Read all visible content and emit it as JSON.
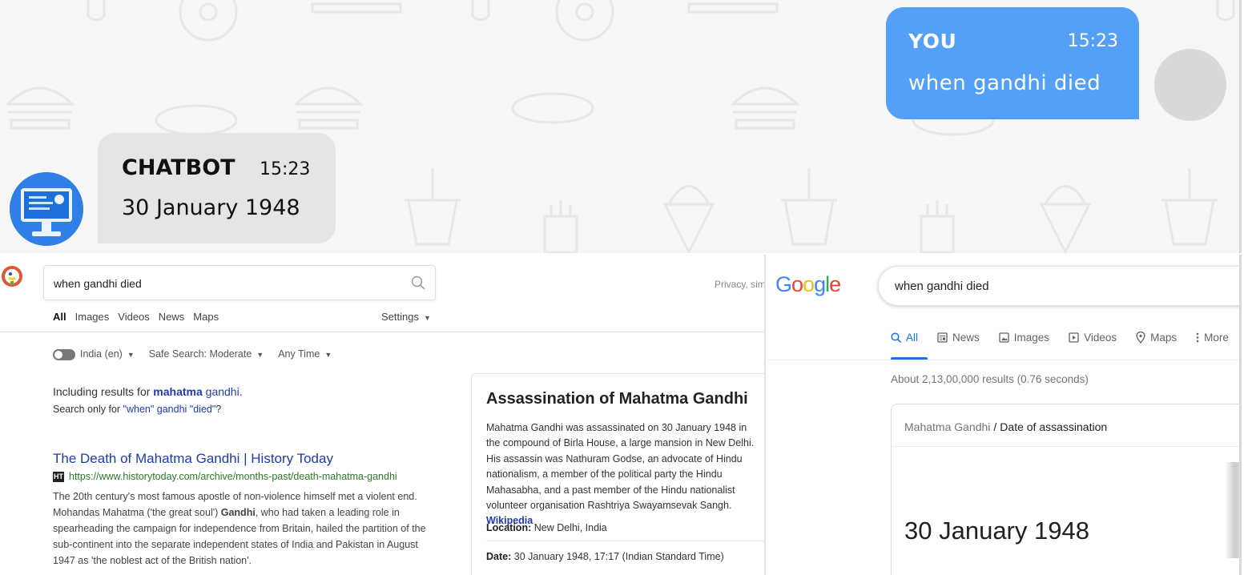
{
  "chat": {
    "user": {
      "name": "YOU",
      "time": "15:23",
      "message": "when gandhi died"
    },
    "bot": {
      "name": "CHATBOT",
      "time": "15:23",
      "message": "30 January 1948"
    },
    "colors": {
      "user_bubble": "#54a0f7",
      "bot_bubble": "#e5e5e5",
      "background": "#f6f6f6"
    }
  },
  "ddg": {
    "logo_icon": "duckduckgo-logo",
    "search_value": "when gandhi died",
    "privacy_text": "Privacy, sim",
    "tabs": [
      "All",
      "Images",
      "Videos",
      "News",
      "Maps"
    ],
    "settings_label": "Settings",
    "filters": {
      "region": "India (en)",
      "safe_search": "Safe Search: Moderate",
      "time": "Any Time"
    },
    "including": {
      "prefix": "Including results for ",
      "bold": "mahatma",
      "rest": " gandhi",
      "end": "."
    },
    "only": {
      "prefix": "Search only for ",
      "link": "\"when\" gandhi \"died\"",
      "end": "?"
    },
    "result": {
      "title": "The Death of Mahatma Gandhi | History Today",
      "url": "https://www.historytoday.com/archive/months-past/death-mahatma-gandhi",
      "favicon": "HT",
      "snippet_a": "The 20th century's most famous apostle of non-violence himself met a violent end. Mohandas Mahatma ('the great soul') ",
      "snippet_bold": "Gandhi",
      "snippet_b": ", who had taken a leading role in spearheading the campaign for independence from Britain, hailed the partition of the sub-continent into the separate independent states of India and Pakistan in August 1947 as 'the noblest act of the British nation'."
    },
    "card": {
      "title": "Assassination of Mahatma Gandhi",
      "body": "Mahatma Gandhi was assassinated on 30 January 1948 in the compound of Birla House, a large mansion in New Delhi. His assassin was Nathuram Godse, an advocate of Hindu nationalism, a member of the political party the Hindu Mahasabha, and a past member of the Hindu nationalist volunteer organisation Rashtriya Swayamsevak Sangh. ",
      "source": "Wikipedia",
      "location_label": "Location:",
      "location": "New Delhi, India",
      "date_label": "Date:",
      "date": "30 January 1948, 17:17 (Indian Standard Time)"
    }
  },
  "google": {
    "logo": "Google",
    "search_value": "when gandhi died",
    "tabs": [
      {
        "label": "All",
        "icon": "search-icon"
      },
      {
        "label": "News",
        "icon": "news-icon"
      },
      {
        "label": "Images",
        "icon": "image-icon"
      },
      {
        "label": "Videos",
        "icon": "video-icon"
      },
      {
        "label": "Maps",
        "icon": "map-pin-icon"
      },
      {
        "label": "More",
        "icon": "more-vertical-icon"
      }
    ],
    "stats": "About 2,13,00,000 results (0.76 seconds)",
    "breadcrumb": {
      "entity": "Mahatma Gandhi",
      "separator": "/",
      "attribute": "Date of assassination"
    },
    "answer": "30 January 1948",
    "colors": {
      "blue": "#4285f4",
      "red": "#ea4335",
      "yellow": "#fbbc05",
      "green": "#34a853",
      "accent": "#1a73e8"
    }
  }
}
